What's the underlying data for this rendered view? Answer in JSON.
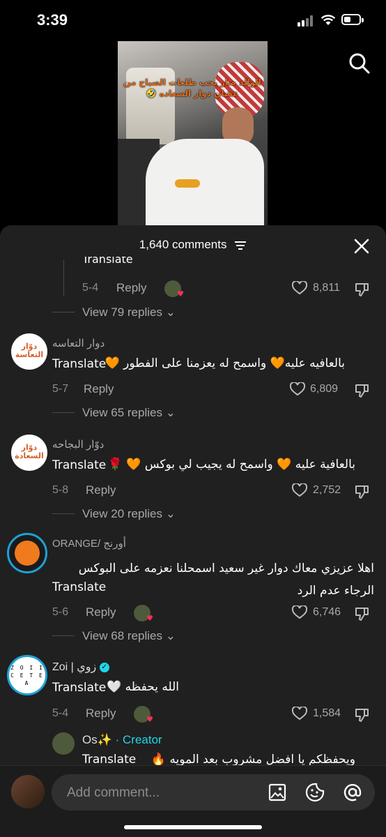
{
  "status_bar": {
    "time": "3:39"
  },
  "video": {
    "caption": "الوالد صار يحب طلعات الصباح من عشان دوار السعاده 🤣"
  },
  "sheet": {
    "title": "1,640 comments"
  },
  "comments": [
    {
      "translate": "Translate",
      "date": "5-4",
      "reply": "Reply",
      "likes": "8,811",
      "view_replies": "View 79 replies"
    },
    {
      "author": "دوار التعاسه",
      "avatar_text": "دوّار التعاسة",
      "text": "بالعافيه عليه🧡 واسمح له يعزمنا على الفطور 🧡",
      "translate": "Translate",
      "date": "5-7",
      "reply": "Reply",
      "likes": "6,809",
      "view_replies": "View 65 replies"
    },
    {
      "author": "دوّار البجاحه",
      "avatar_text": "دوّار السعادة",
      "text": "بالعافية عليه 🧡 واسمح له يجيب لي بوكس 🧡 🌹",
      "translate": "Translate",
      "date": "5-8",
      "reply": "Reply",
      "likes": "2,752",
      "view_replies": "View 20 replies"
    },
    {
      "author": "ORANGE/ أورنج",
      "text": "اهلا عزيزي معاك دوار غير سعيد اسمحلنا نعزمه على البوكس الرجاء عدم الرد",
      "translate": "Translate",
      "date": "5-6",
      "reply": "Reply",
      "likes": "6,746",
      "view_replies": "View 68 replies"
    },
    {
      "author": "Zoi | زوي",
      "avatar_text": "Z O I I C E T E A",
      "text": "الله يحفظه 🤍",
      "translate": "Translate",
      "date": "5-4",
      "reply": "Reply",
      "likes": "1,584"
    }
  ],
  "nested_reply": {
    "author": "Os✨",
    "creator_label": "· Creator",
    "translate": "Translate",
    "text": "ويحفظكم يا افضل مشروب بعد المويه 🔥"
  },
  "composer": {
    "placeholder": "Add comment..."
  },
  "colors": {
    "accent": "#20d5ec",
    "like_badge": "#ff2e55",
    "sheet_bg": "#202020"
  }
}
